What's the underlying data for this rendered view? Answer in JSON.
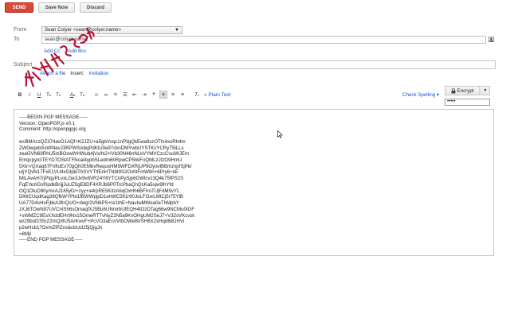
{
  "toolbar_top": {
    "send_label": "SEND",
    "save_label": "Save Now",
    "discard_label": "Discard"
  },
  "header": {
    "from_label": "From",
    "from_value": "Sean Colyer <sean@colyer.name>",
    "to_label": "To",
    "to_value": "sean@colyer.name,",
    "add_cc": "Add Cc",
    "add_bcc": "Add Bcc",
    "subject_label": "Subject",
    "attach_label": "Attach a file",
    "insert_label": "Insert:",
    "invitation_label": "Invitation"
  },
  "format_bar": {
    "plain_text": "« Plain Text",
    "check_spelling": "Check Spelling",
    "encrypt_label": "Encrypt",
    "password_value": "•••••"
  },
  "message": {
    "lines": [
      "-----BEGIN PGP MESSAGE-----",
      "Version: OpenPGP.js v0.1",
      "Comment: http://openpgpjs.org",
      "",
      "wcBMAzzQZ374avO1AQf+K2JZU+a5gbVvqc1nPilgQkEwa8szOTfc4xoRh4m",
      "ZW0wqebSxWf4evJ3RPWSAbqPdKlU0e97cknDMYwbUYSTKcYCRyT5lLLs",
      "zeaGVN69RhU5mBOxwWHWub4jVx/hlJ+iVb30N46nNLkVYMVCzcCvuiWJEm",
      "EmqcpyIcITEYD7OSlATFNcai4ypbSLedm6hRpwCP5hkFoQMLzJIzO9HmU",
      "5Xk+/QXaq67FnfIuEx70gQh0EMbvRequsHM9WFDXRjUP9OyovlBBmzvpfSjPk/",
      "utjYQvN17FxE1VU4x53pkiThSVYTIfEnHTNbt9S2OvhtFmW8n+6Pry6+kE",
      "MILAvAH7rjPtqyPLvxLGe3Jx9v8VR24Y8YTCnPySjp6GWlcvz3Q4k75fPS2S",
      "FqEYeziGsf0pdkBrijjJuUZ0gE8DF4XRJb6P0TrcPbaQnQcKa5sjw9lhYfd",
      "OQ1DtuD90ymxAJ185yD/+zyy+a4rpRE563zA6qOxHh6BFIroTUjFdM5vYL",
      "DlWCUqdKag38QfkWYPbi1fBWWpjpD1ehWC5fl1r90JoLFOxrLMICj5r75YlB",
      "UA77D4sHsFjbkA3fnQc/O+dwg/2VN6PS+re1thE+NavIwMWea0eThMpbY",
      "zXJ6TOwN87UVCnISh6sOmaqfXJ5Bu6UNmrbUfEQH4tOzDTag66w9NCMu0tGF",
      "+sWMZC9EsXXddEHr9Nx15OmeRTTvNyZ2N5a9KvOHgUM2SeJ7+V32sVKcvsk",
      "wr29bof2S5rZ2mQ/8U5ArKwvF+PcVO3aEcvVIbOWeBtrSH6X2xHqd6l8JHVi",
      "p2wHcb17OvmZlPZns&cbUcl25jQjgJn",
      "=8MjI",
      "-----END PGP MESSAGE-----"
    ]
  }
}
